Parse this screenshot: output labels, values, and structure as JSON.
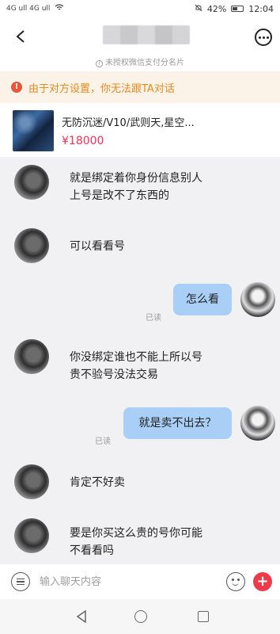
{
  "status_bar": {
    "left": "4G ull 4G ull",
    "battery": "42%",
    "time": "12:04"
  },
  "header": {
    "back_icon": "chevron-left-icon",
    "contact_name": "",
    "auth_note": "未授权微信支付分名片",
    "more_icon": "more-dots-icon"
  },
  "warning": {
    "text": "由于对方设置，你无法跟TA对话",
    "icon": "exclamation-icon",
    "color": "#e8553a"
  },
  "product": {
    "title": "无防沉迷/V10/武则天,星空...",
    "price": "¥18000"
  },
  "messages": [
    {
      "from": "other",
      "lines": [
        "就是绑定着你身份信息别人",
        "上号是改不了东西的"
      ]
    },
    {
      "from": "other",
      "lines": [
        "可以看看号"
      ]
    },
    {
      "from": "self",
      "text": "怎么看",
      "status": "已读"
    },
    {
      "from": "other",
      "lines": [
        "你没绑定谁也不能上所以号",
        "贵不验号没法交易"
      ]
    },
    {
      "from": "self",
      "text": "就是卖不出去？",
      "status": "已读"
    },
    {
      "from": "other",
      "lines": [
        "肯定不好卖"
      ]
    },
    {
      "from": "other",
      "lines": [
        "要是你买这么贵的号你可能",
        "不看看吗"
      ]
    }
  ],
  "input": {
    "placeholder": "输入聊天内容",
    "value": ""
  },
  "colors": {
    "self_bubble": "#a9cff7",
    "price": "#e8335a",
    "warning_text": "#e58a1f",
    "plus_button": "#ee3b4c"
  }
}
